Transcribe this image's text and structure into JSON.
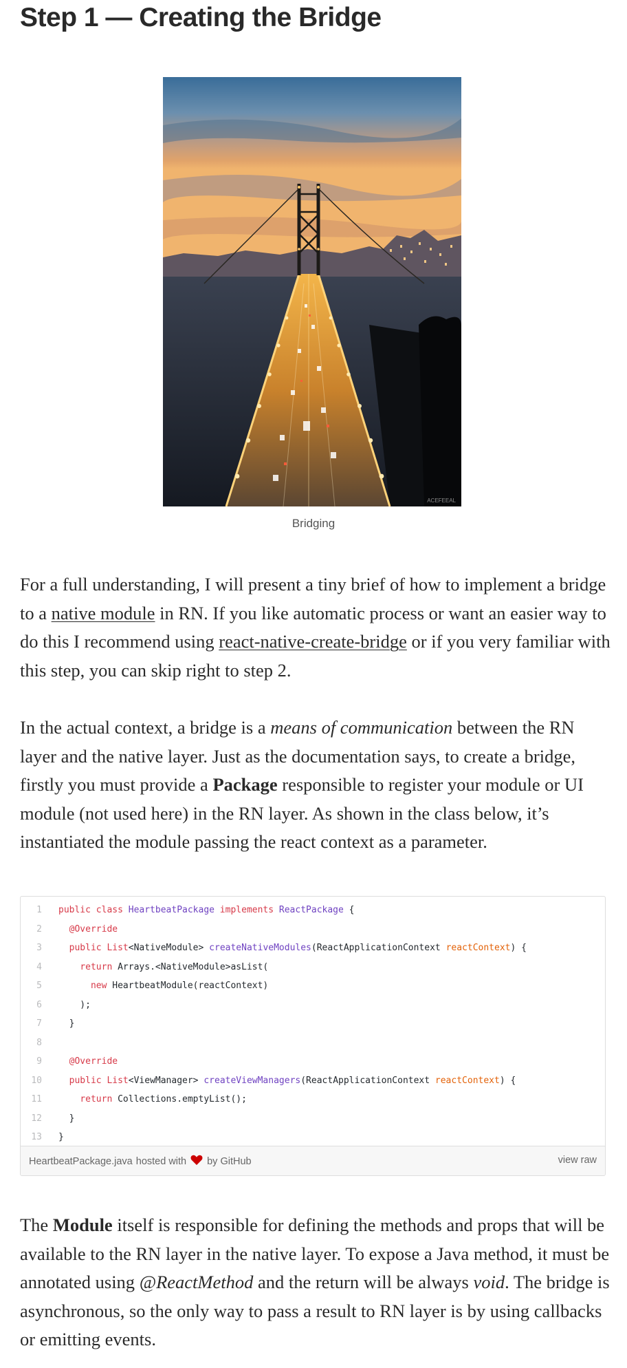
{
  "heading": "Step 1 — Creating the Bridge",
  "figure": {
    "caption": "Bridging",
    "image_label": "ACEFEEAL"
  },
  "paragraph1": {
    "t1": "For a full understanding, I will present a tiny brief of how to implement a bridge to a ",
    "link1": "native module",
    "t2": " in RN. If you like automatic process or want an easier way to do this I recommend using ",
    "link2": "react-native-create-bridge",
    "t3": " or if you very familiar with this step, you can skip right to step 2."
  },
  "paragraph2": {
    "t1": "In the actual context, a bridge is a ",
    "em1": "means of communication",
    "t2": " between the RN layer and the native layer. Just as the documentation says, to create a bridge, firstly you must provide a ",
    "strong1": "Package",
    "t3": " responsible to register your module or UI module (not used here) in the RN layer. As shown in the class below, it’s instantiated the module passing the react context as a parameter."
  },
  "gist": {
    "lines": [
      {
        "n": "1",
        "parts": [
          {
            "t": "public class ",
            "c": "kw"
          },
          {
            "t": "HeartbeatPackage",
            "c": "ty"
          },
          {
            "t": " implements ",
            "c": "kw"
          },
          {
            "t": "ReactPackage",
            "c": "ty"
          },
          {
            "t": " {",
            "c": ""
          }
        ]
      },
      {
        "n": "2",
        "parts": [
          {
            "t": "  ",
            "c": ""
          },
          {
            "t": "@Override",
            "c": "kw"
          }
        ]
      },
      {
        "n": "3",
        "parts": [
          {
            "t": "  ",
            "c": ""
          },
          {
            "t": "public ",
            "c": "kw"
          },
          {
            "t": "List",
            "c": "kw"
          },
          {
            "t": "<NativeModule> ",
            "c": ""
          },
          {
            "t": "createNativeModules",
            "c": "ty"
          },
          {
            "t": "(ReactApplicationContext ",
            "c": ""
          },
          {
            "t": "reactContext",
            "c": "pm"
          },
          {
            "t": ") {",
            "c": ""
          }
        ]
      },
      {
        "n": "4",
        "parts": [
          {
            "t": "    ",
            "c": ""
          },
          {
            "t": "return ",
            "c": "kw"
          },
          {
            "t": "Arrays.<NativeModule>asList(",
            "c": ""
          }
        ]
      },
      {
        "n": "5",
        "parts": [
          {
            "t": "      ",
            "c": ""
          },
          {
            "t": "new ",
            "c": "kw"
          },
          {
            "t": "HeartbeatModule(reactContext)",
            "c": ""
          }
        ]
      },
      {
        "n": "6",
        "parts": [
          {
            "t": "    );",
            "c": ""
          }
        ]
      },
      {
        "n": "7",
        "parts": [
          {
            "t": "  }",
            "c": ""
          }
        ]
      },
      {
        "n": "8",
        "parts": [
          {
            "t": "",
            "c": ""
          }
        ]
      },
      {
        "n": "9",
        "parts": [
          {
            "t": "  ",
            "c": ""
          },
          {
            "t": "@Override",
            "c": "kw"
          }
        ]
      },
      {
        "n": "10",
        "parts": [
          {
            "t": "  ",
            "c": ""
          },
          {
            "t": "public ",
            "c": "kw"
          },
          {
            "t": "List",
            "c": "kw"
          },
          {
            "t": "<ViewManager> ",
            "c": ""
          },
          {
            "t": "createViewManagers",
            "c": "ty"
          },
          {
            "t": "(ReactApplicationContext ",
            "c": ""
          },
          {
            "t": "reactContext",
            "c": "pm"
          },
          {
            "t": ") {",
            "c": ""
          }
        ]
      },
      {
        "n": "11",
        "parts": [
          {
            "t": "    ",
            "c": ""
          },
          {
            "t": "return ",
            "c": "kw"
          },
          {
            "t": "Collections.emptyList();",
            "c": ""
          }
        ]
      },
      {
        "n": "12",
        "parts": [
          {
            "t": "  }",
            "c": ""
          }
        ]
      },
      {
        "n": "13",
        "parts": [
          {
            "t": "}",
            "c": ""
          }
        ]
      }
    ],
    "filename": "HeartbeatPackage.java",
    "hosted_with": "hosted with",
    "by_github": "by GitHub",
    "view_raw": "view raw",
    "heart_icon": "heart-icon",
    "heart_color": "#cc0000"
  },
  "paragraph3": {
    "t1": "The ",
    "strong1": "Module",
    "t2": " itself is responsible for defining the methods and props that will be available to the RN layer in the native layer. To expose a Java method, it must be annotated using ",
    "em1": "@ReactMethod",
    "t3": " and the return will be always ",
    "em2": "void",
    "t4": ". The bridge is asynchronous, so the only way to pass a result to RN layer is by using callbacks or emitting events."
  }
}
